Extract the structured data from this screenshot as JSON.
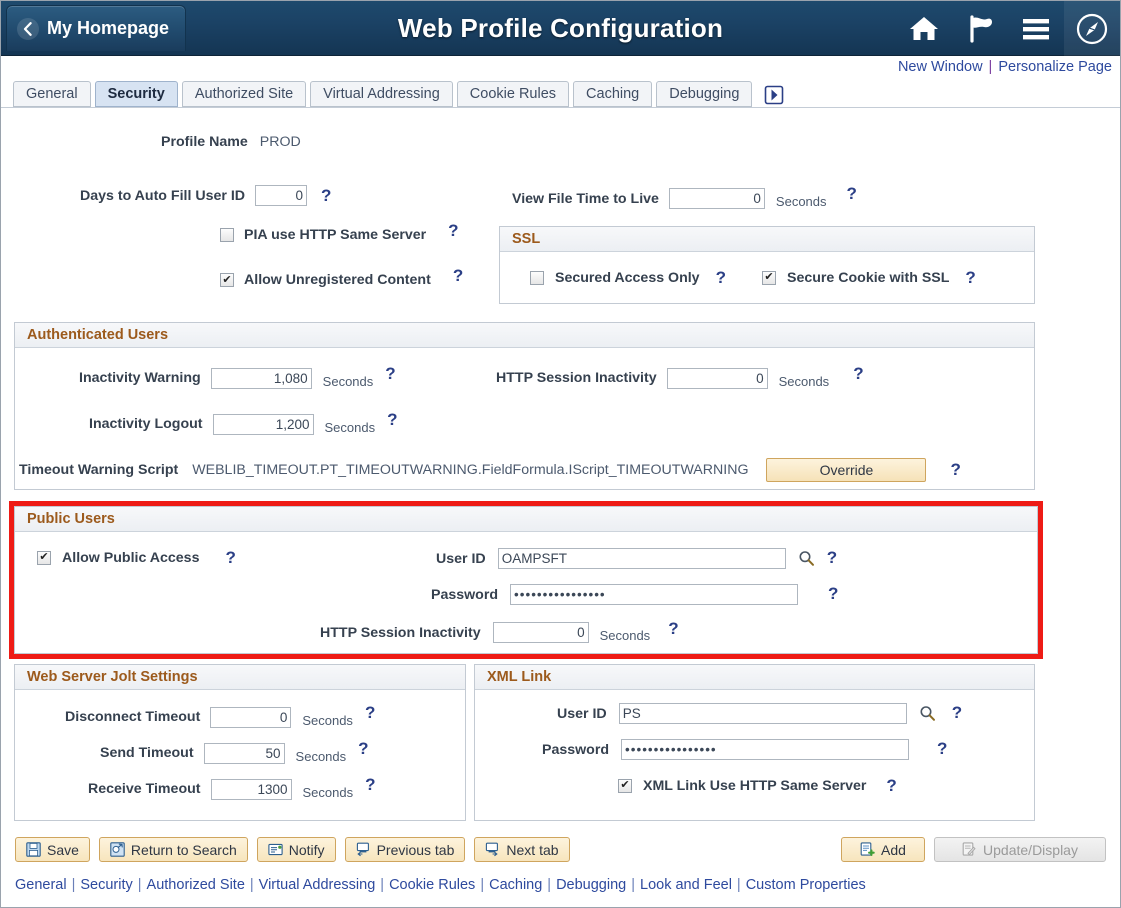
{
  "header": {
    "homepage_label": "My Homepage",
    "title": "Web Profile Configuration",
    "icons": [
      {
        "name": "home-icon"
      },
      {
        "name": "flag-icon"
      },
      {
        "name": "hamburger-menu-icon"
      },
      {
        "name": "navbar-compass-icon"
      }
    ]
  },
  "toplinks": {
    "new_window": "New Window",
    "separator": "|",
    "personalize_page": "Personalize Page"
  },
  "tabs": [
    {
      "label": "General",
      "active": false
    },
    {
      "label": "Security",
      "active": true
    },
    {
      "label": "Authorized Site",
      "active": false
    },
    {
      "label": "Virtual Addressing",
      "active": false
    },
    {
      "label": "Cookie Rules",
      "active": false
    },
    {
      "label": "Caching",
      "active": false
    },
    {
      "label": "Debugging",
      "active": false
    }
  ],
  "profile": {
    "name_label": "Profile Name",
    "name_value": "PROD"
  },
  "top_fields": {
    "days_auto_fill_label": "Days to Auto Fill User ID",
    "days_auto_fill_value": "0",
    "view_file_ttl_label": "View File Time to Live",
    "view_file_ttl_value": "0",
    "view_file_ttl_unit": "Seconds",
    "pia_http_same_server_label": "PIA use HTTP Same Server",
    "pia_http_same_server_checked": false,
    "allow_unregistered_label": "Allow Unregistered Content",
    "allow_unregistered_checked": true
  },
  "ssl": {
    "title": "SSL",
    "secured_access_only_label": "Secured Access Only",
    "secured_access_only_checked": false,
    "secure_cookie_ssl_label": "Secure Cookie with SSL",
    "secure_cookie_ssl_checked": true
  },
  "authenticated_users": {
    "title": "Authenticated Users",
    "inactivity_warning_label": "Inactivity Warning",
    "inactivity_warning_value": "1,080",
    "inactivity_warning_unit": "Seconds",
    "inactivity_logout_label": "Inactivity Logout",
    "inactivity_logout_value": "1,200",
    "inactivity_logout_unit": "Seconds",
    "http_session_inactivity_label": "HTTP Session Inactivity",
    "http_session_inactivity_value": "0",
    "http_session_inactivity_unit": "Seconds",
    "timeout_script_label": "Timeout Warning Script",
    "timeout_script_value": "WEBLIB_TIMEOUT.PT_TIMEOUTWARNING.FieldFormula.IScript_TIMEOUTWARNING",
    "override_button": "Override"
  },
  "public_users": {
    "title": "Public Users",
    "allow_public_access_label": "Allow Public Access",
    "allow_public_access_checked": true,
    "user_id_label": "User ID",
    "user_id_value": "OAMPSFT",
    "password_label": "Password",
    "password_value": "••••••••••••••••",
    "http_session_inactivity_label": "HTTP Session Inactivity",
    "http_session_inactivity_value": "0",
    "http_session_inactivity_unit": "Seconds",
    "highlight_color": "#ee1b15"
  },
  "jolt": {
    "title": "Web Server Jolt Settings",
    "disconnect_timeout_label": "Disconnect Timeout",
    "disconnect_timeout_value": "0",
    "disconnect_timeout_unit": "Seconds",
    "send_timeout_label": "Send Timeout",
    "send_timeout_value": "50",
    "send_timeout_unit": "Seconds",
    "receive_timeout_label": "Receive Timeout",
    "receive_timeout_value": "1300",
    "receive_timeout_unit": "Seconds"
  },
  "xml_link": {
    "title": "XML Link",
    "user_id_label": "User ID",
    "user_id_value": "PS",
    "password_label": "Password",
    "password_value": "••••••••••••••••",
    "same_server_label": "XML Link Use HTTP Same Server",
    "same_server_checked": true
  },
  "toolbar": {
    "save_label": "Save",
    "return_to_search_label": "Return to Search",
    "notify_label": "Notify",
    "previous_tab_label": "Previous tab",
    "next_tab_label": "Next tab",
    "add_label": "Add",
    "update_display_label": "Update/Display"
  },
  "footer_links": [
    "General",
    "Security",
    "Authorized Site",
    "Virtual Addressing",
    "Cookie Rules",
    "Caching",
    "Debugging",
    "Look and Feel",
    "Custom Properties"
  ],
  "help_glyph": "?"
}
